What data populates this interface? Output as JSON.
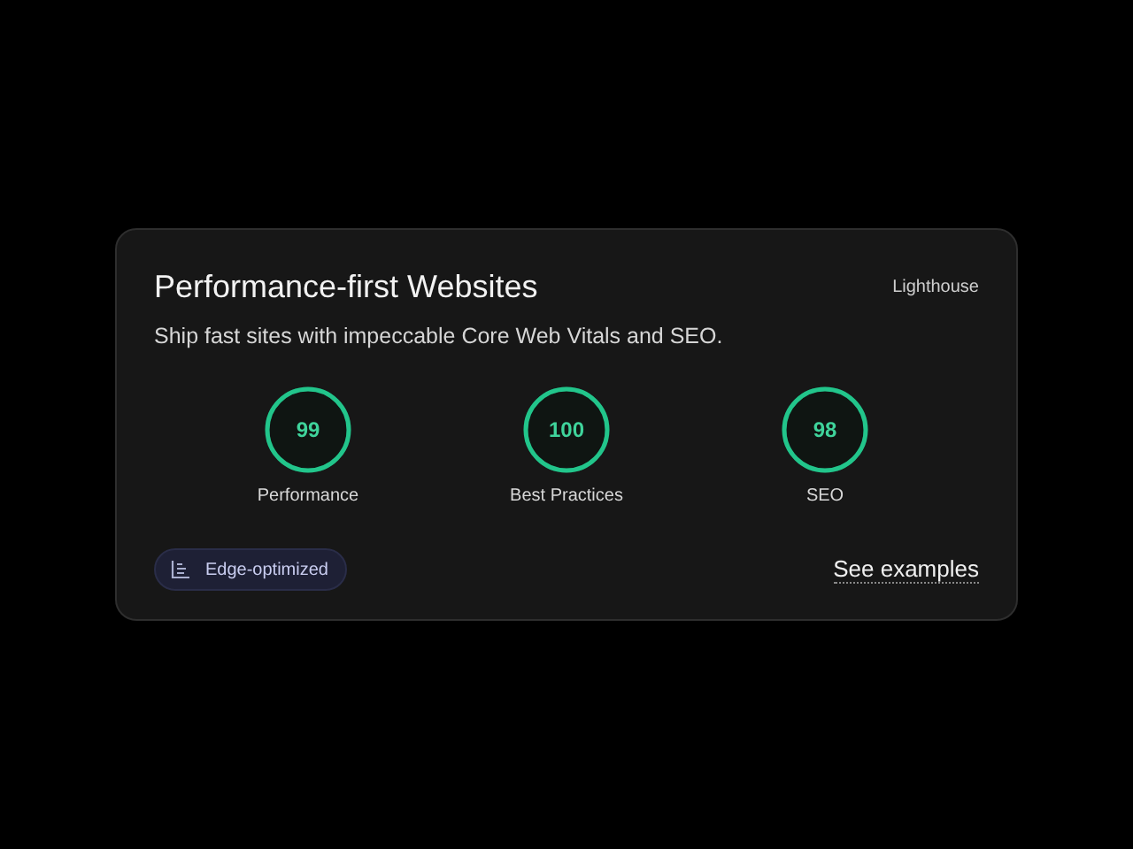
{
  "card": {
    "title": "Performance-first Websites",
    "source": "Lighthouse",
    "subtitle": "Ship fast sites with impeccable Core Web Vitals and SEO.",
    "scores": [
      {
        "value": "99",
        "label": "Performance"
      },
      {
        "value": "100",
        "label": "Best Practices"
      },
      {
        "value": "98",
        "label": "SEO"
      }
    ],
    "badge": "Edge-optimized",
    "link": "See examples"
  }
}
